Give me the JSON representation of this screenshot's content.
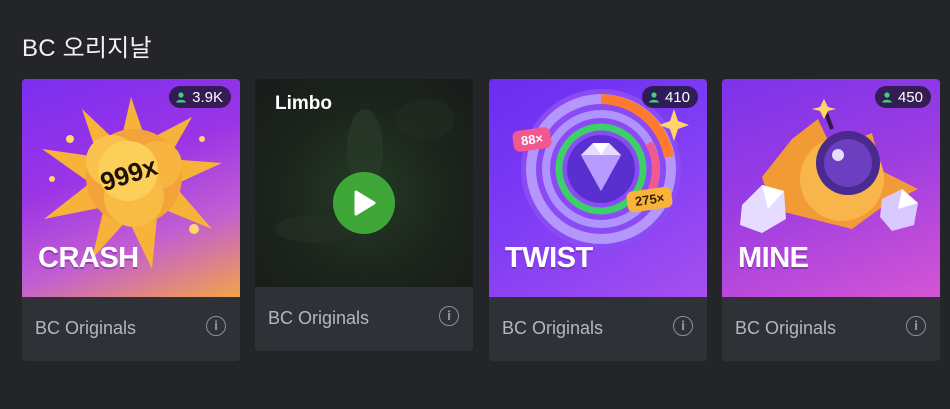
{
  "section": {
    "title": "BC 오리지날"
  },
  "cards": [
    {
      "game": "CRASH",
      "multiplier": "999x",
      "players": "3.9K",
      "provider": "BC Originals",
      "info_icon": "i"
    },
    {
      "game": "Limbo",
      "provider": "BC Originals",
      "info_icon": "i",
      "state": "hovered-play"
    },
    {
      "game": "TWIST",
      "mult_a": "88×",
      "mult_b": "275×",
      "players": "410",
      "provider": "BC Originals",
      "info_icon": "i"
    },
    {
      "game": "MINE",
      "players": "450",
      "provider": "BC Originals",
      "info_icon": "i"
    }
  ],
  "colors": {
    "background": "#232528",
    "card": "#2f3136",
    "provider_text": "#b4b7bd",
    "play_green": "#3fa638"
  }
}
